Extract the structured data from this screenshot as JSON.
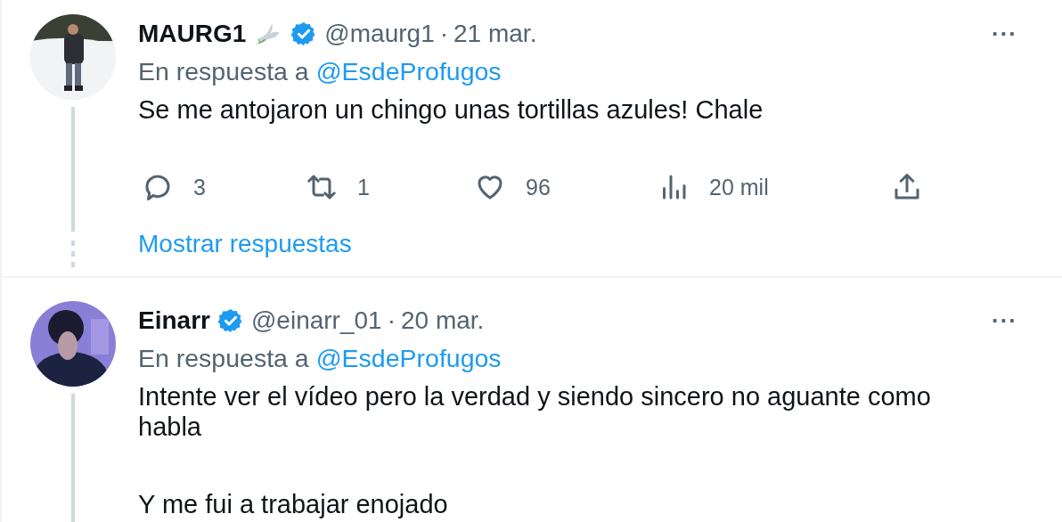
{
  "tweets": [
    {
      "name": "MAURG1",
      "dove_emblem": true,
      "verified": true,
      "handle": "@maurg1",
      "separator": "·",
      "date": "21 mar.",
      "more": "···",
      "reply_prefix": "En respuesta a",
      "reply_to": "@EsdeProfugos",
      "paragraphs": [
        "Se me antojaron un chingo unas tortillas azules! Chale"
      ],
      "actions": [
        {
          "kind": "reply",
          "count": "3"
        },
        {
          "kind": "retweet",
          "count": "1"
        },
        {
          "kind": "like",
          "count": "96"
        },
        {
          "kind": "views",
          "count": "20 mil"
        },
        {
          "kind": "share"
        }
      ],
      "show_replies": "Mostrar respuestas",
      "avatar": {
        "kind": "picture"
      }
    },
    {
      "name": "Einarr",
      "dove_emblem": false,
      "verified": true,
      "handle": "@einarr_01",
      "separator": "·",
      "date": "20 mar.",
      "more": "···",
      "reply_prefix": "En respuesta a",
      "reply_to": "@EsdeProfugos",
      "paragraphs": [
        "Intente ver el vídeo pero la verdad y siendo sincero no aguante como habla",
        "Y me fui a trabajar enojado"
      ],
      "avatar": {
        "kind": "picture"
      }
    }
  ]
}
